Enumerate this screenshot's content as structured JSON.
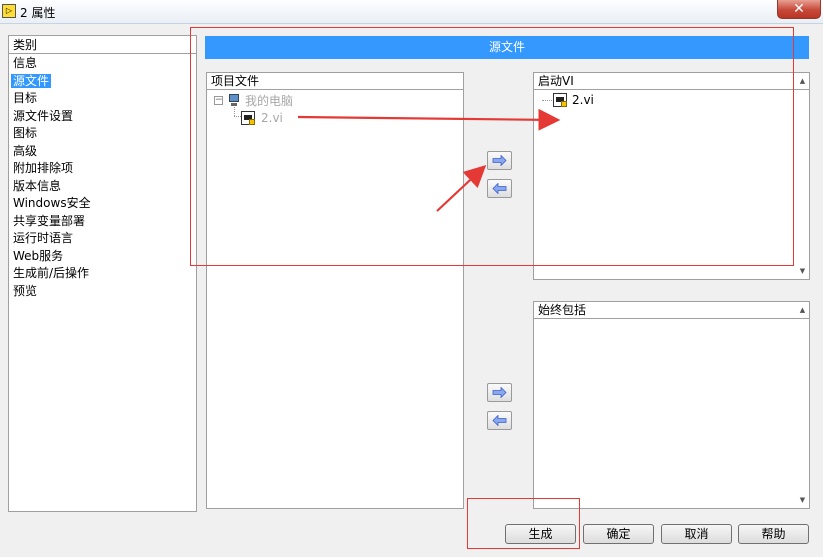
{
  "window": {
    "title": "2 属性",
    "app_icon": "labview-icon"
  },
  "category": {
    "header": "类别",
    "items": [
      "信息",
      "源文件",
      "目标",
      "源文件设置",
      "图标",
      "高级",
      "附加排除项",
      "版本信息",
      "Windows安全",
      "共享变量部署",
      "运行时语言",
      "Web服务",
      "生成前/后操作",
      "预览"
    ],
    "selected": "源文件"
  },
  "section_title": "源文件",
  "project_files": {
    "header": "项目文件",
    "tree": [
      {
        "label": "我的电脑",
        "icon": "computer-icon",
        "expanded": true
      },
      {
        "label": "2.vi",
        "icon": "vi-file-icon"
      }
    ]
  },
  "startup_vis": {
    "header": "启动VI",
    "items": [
      {
        "label": "2.vi",
        "icon": "vi-file-icon"
      }
    ]
  },
  "always_included": {
    "header": "始终包括",
    "items": []
  },
  "buttons": {
    "build": "生成",
    "ok": "确定",
    "cancel": "取消",
    "help": "帮助"
  },
  "colors": {
    "accent": "#3399ff",
    "annotation": "#e53935"
  }
}
